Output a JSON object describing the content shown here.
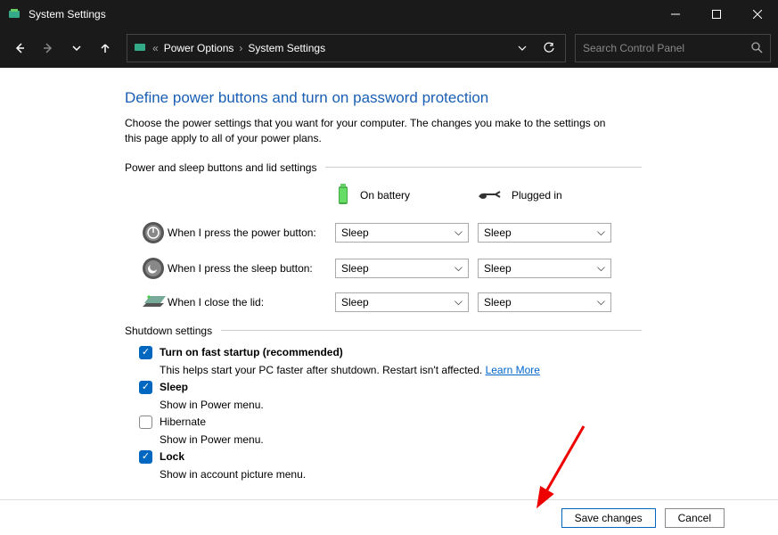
{
  "window": {
    "title": "System Settings"
  },
  "breadcrumb": {
    "part1": "Power Options",
    "part2": "System Settings"
  },
  "search": {
    "placeholder": "Search Control Panel"
  },
  "page": {
    "heading": "Define power buttons and turn on password protection",
    "description": "Choose the power settings that you want for your computer. The changes you make to the settings on this page apply to all of your power plans.",
    "section1": "Power and sleep buttons and lid settings",
    "col_battery": "On battery",
    "col_plugged": "Plugged in",
    "rows": {
      "power": {
        "label": "When I press the power button:",
        "battery": "Sleep",
        "plugged": "Sleep"
      },
      "sleep": {
        "label": "When I press the sleep button:",
        "battery": "Sleep",
        "plugged": "Sleep"
      },
      "lid": {
        "label": "When I close the lid:",
        "battery": "Sleep",
        "plugged": "Sleep"
      }
    },
    "section2": "Shutdown settings",
    "shutdown": {
      "faststartup": {
        "title": "Turn on fast startup (recommended)",
        "sub_pre": "This helps start your PC faster after shutdown. Restart isn't affected. ",
        "link": "Learn More",
        "checked": true
      },
      "sleep": {
        "title": "Sleep",
        "sub": "Show in Power menu.",
        "checked": true
      },
      "hibernate": {
        "title": "Hibernate",
        "sub": "Show in Power menu.",
        "checked": false
      },
      "lock": {
        "title": "Lock",
        "sub": "Show in account picture menu.",
        "checked": true
      }
    }
  },
  "footer": {
    "save": "Save changes",
    "cancel": "Cancel"
  }
}
